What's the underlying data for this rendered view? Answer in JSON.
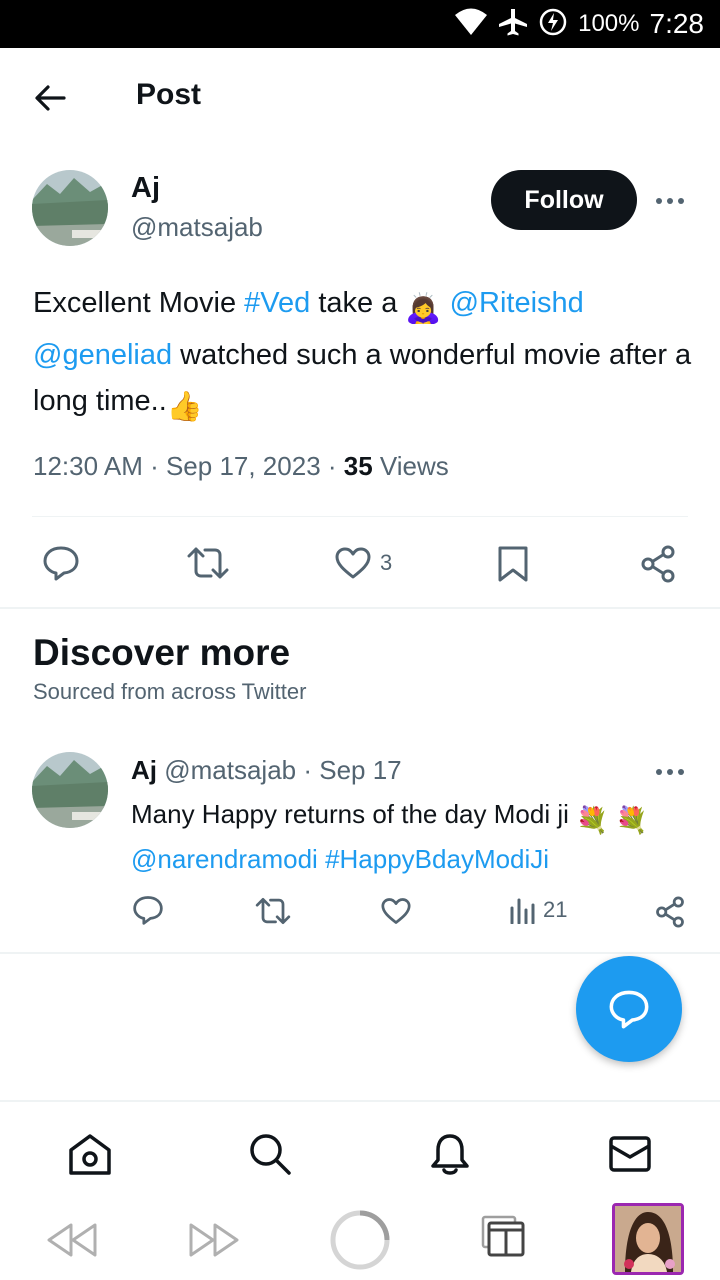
{
  "status_bar": {
    "battery": "100%",
    "time": "7:28",
    "icons": [
      "wifi-icon",
      "airplane-icon",
      "battery-saver-icon"
    ]
  },
  "header": {
    "title": "Post",
    "back_icon": "arrow-left-icon"
  },
  "post": {
    "author_name": "Aj",
    "author_handle": "@matsajab",
    "follow_label": "Follow",
    "text": {
      "p1": "Excellent Movie ",
      "tag_ved": "#Ved",
      "p2": " take a ",
      "emoji_bow": "🙇‍♀️",
      "mention_riteish": "@Riteishd",
      "mention_genelia": "@geneliad",
      "p3": " watched such a wonderful movie after a long time..",
      "emoji_thumb": "👍"
    },
    "timestamp": "12:30 AM · Sep 17, 2023 · ",
    "views_count": "35",
    "views_label": " Views",
    "actions": {
      "reply": "",
      "retweet": "",
      "like_count": "3",
      "bookmark": "",
      "share": ""
    }
  },
  "discover": {
    "title": "Discover more",
    "subtitle": "Sourced from across Twitter"
  },
  "tweet2": {
    "author_name": "Aj",
    "handle_date": " @matsajab · Sep 17",
    "text": {
      "p1": "Many Happy returns of the day Modi ji ",
      "emoji_flower": "💐",
      "mention": "@narendramodi",
      "hashtag": "#HappyBdayModiJi"
    },
    "views_count": "21"
  },
  "bottom_nav": [
    "home-icon",
    "search-icon",
    "notifications-icon",
    "messages-icon"
  ],
  "browser_bar": [
    "rewind-icon",
    "fast-forward-icon",
    "loading-icon",
    "tabs-icon"
  ],
  "colors": {
    "accent": "#1d9bf0",
    "text": "#0f1419",
    "muted": "#536471",
    "divider": "#eff3f4"
  }
}
